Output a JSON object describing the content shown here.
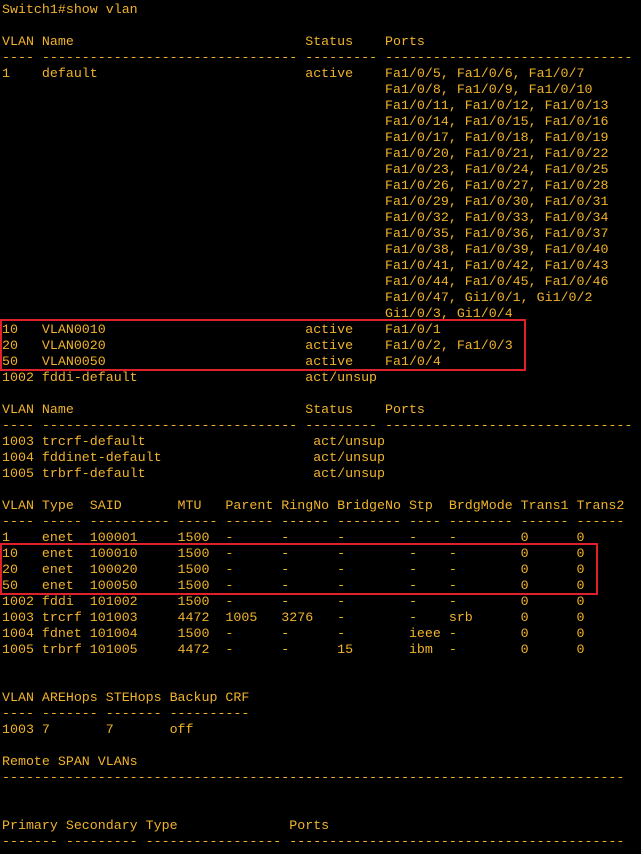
{
  "terminal": {
    "lines": [
      {
        "row": 0,
        "text": "Switch1#show vlan"
      },
      {
        "row": 2,
        "text": "VLAN Name                             Status    Ports"
      },
      {
        "row": 3,
        "text": "---- -------------------------------- --------- -------------------------------"
      },
      {
        "row": 4,
        "text": "1    default                          active    Fa1/0/5, Fa1/0/6, Fa1/0/7"
      },
      {
        "row": 5,
        "text": "                                                Fa1/0/8, Fa1/0/9, Fa1/0/10"
      },
      {
        "row": 6,
        "text": "                                                Fa1/0/11, Fa1/0/12, Fa1/0/13"
      },
      {
        "row": 7,
        "text": "                                                Fa1/0/14, Fa1/0/15, Fa1/0/16"
      },
      {
        "row": 8,
        "text": "                                                Fa1/0/17, Fa1/0/18, Fa1/0/19"
      },
      {
        "row": 9,
        "text": "                                                Fa1/0/20, Fa1/0/21, Fa1/0/22"
      },
      {
        "row": 10,
        "text": "                                                Fa1/0/23, Fa1/0/24, Fa1/0/25"
      },
      {
        "row": 11,
        "text": "                                                Fa1/0/26, Fa1/0/27, Fa1/0/28"
      },
      {
        "row": 12,
        "text": "                                                Fa1/0/29, Fa1/0/30, Fa1/0/31"
      },
      {
        "row": 13,
        "text": "                                                Fa1/0/32, Fa1/0/33, Fa1/0/34"
      },
      {
        "row": 14,
        "text": "                                                Fa1/0/35, Fa1/0/36, Fa1/0/37"
      },
      {
        "row": 15,
        "text": "                                                Fa1/0/38, Fa1/0/39, Fa1/0/40"
      },
      {
        "row": 16,
        "text": "                                                Fa1/0/41, Fa1/0/42, Fa1/0/43"
      },
      {
        "row": 17,
        "text": "                                                Fa1/0/44, Fa1/0/45, Fa1/0/46"
      },
      {
        "row": 18,
        "text": "                                                Fa1/0/47, Gi1/0/1, Gi1/0/2"
      },
      {
        "row": 19,
        "text": "                                                Gi1/0/3, Gi1/0/4"
      },
      {
        "row": 20,
        "text": "10   VLAN0010                         active    Fa1/0/1"
      },
      {
        "row": 21,
        "text": "20   VLAN0020                         active    Fa1/0/2, Fa1/0/3"
      },
      {
        "row": 22,
        "text": "50   VLAN0050                         active    Fa1/0/4"
      },
      {
        "row": 23,
        "text": "1002 fddi-default                     act/unsup"
      },
      {
        "row": 25,
        "text": "VLAN Name                             Status    Ports"
      },
      {
        "row": 26,
        "text": "---- -------------------------------- --------- -------------------------------"
      },
      {
        "row": 27,
        "text": "1003 trcrf-default                     act/unsup"
      },
      {
        "row": 28,
        "text": "1004 fddinet-default                   act/unsup"
      },
      {
        "row": 29,
        "text": "1005 trbrf-default                     act/unsup"
      },
      {
        "row": 31,
        "text": "VLAN Type  SAID       MTU   Parent RingNo BridgeNo Stp  BrdgMode Trans1 Trans2"
      },
      {
        "row": 32,
        "text": "---- ----- ---------- ----- ------ ------ -------- ---- -------- ------ ------"
      },
      {
        "row": 33,
        "text": "1    enet  100001     1500  -      -      -        -    -        0      0"
      },
      {
        "row": 34,
        "text": "10   enet  100010     1500  -      -      -        -    -        0      0"
      },
      {
        "row": 35,
        "text": "20   enet  100020     1500  -      -      -        -    -        0      0"
      },
      {
        "row": 36,
        "text": "50   enet  100050     1500  -      -      -        -    -        0      0"
      },
      {
        "row": 37,
        "text": "1002 fddi  101002     1500  -      -      -        -    -        0      0"
      },
      {
        "row": 38,
        "text": "1003 trcrf 101003     4472  1005   3276   -        -    srb      0      0"
      },
      {
        "row": 39,
        "text": "1004 fdnet 101004     1500  -      -      -        ieee -        0      0"
      },
      {
        "row": 40,
        "text": "1005 trbrf 101005     4472  -      -      15       ibm  -        0      0"
      },
      {
        "row": 43,
        "text": "VLAN AREHops STEHops Backup CRF"
      },
      {
        "row": 44,
        "text": "---- ------- ------- ----------"
      },
      {
        "row": 45,
        "text": "1003 7       7       off"
      },
      {
        "row": 47,
        "text": "Remote SPAN VLANs"
      },
      {
        "row": 48,
        "text": "------------------------------------------------------------------------------"
      },
      {
        "row": 51,
        "text": "Primary Secondary Type              Ports"
      },
      {
        "row": 52,
        "text": "------- --------- ----------------- ------------------------------------------"
      }
    ]
  },
  "highlights": [
    {
      "name": "vlan-ports-highlight",
      "rows": [
        20,
        22
      ],
      "cols": [
        0,
        65
      ]
    },
    {
      "name": "vlan-type-highlight",
      "rows": [
        34,
        36
      ],
      "cols": [
        0,
        74
      ]
    }
  ],
  "colors": {
    "background": "#000000",
    "text": "#f0b32c",
    "highlight_border": "#e0202a"
  }
}
